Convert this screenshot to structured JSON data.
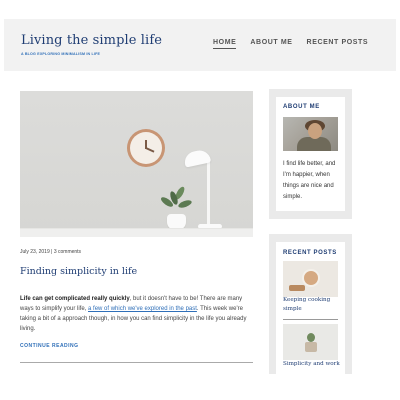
{
  "site": {
    "title": "Living the simple life",
    "tagline": "A BLOG EXPLORING MINIMALISM IN LIFE"
  },
  "nav": {
    "items": [
      {
        "label": "HOME",
        "active": true
      },
      {
        "label": "ABOUT ME",
        "active": false
      },
      {
        "label": "RECENT POSTS",
        "active": false
      }
    ]
  },
  "post": {
    "date": "July 23, 2019",
    "separator": " | ",
    "comments": "3 comments",
    "title": "Finding simplicity in life",
    "excerpt_bold": "Life can get complicated really quickly",
    "excerpt_part1": ", but it doesn't have to be! There are many ways to simplify your life, ",
    "excerpt_link": "a few of which we've explored in the past",
    "excerpt_part2": ". This week we're taking a bit of a approach though, in how you can find simplicity in the life you already living.",
    "continue_label": "CONTINUE READING"
  },
  "sidebar": {
    "about": {
      "title": "ABOUT ME",
      "text": "I find life better, and I'm happier, when things are nice and simple."
    },
    "recent": {
      "title": "RECENT POSTS",
      "items": [
        {
          "label": "Keeping cooking simple"
        },
        {
          "label": "Simplicity and work"
        }
      ]
    }
  },
  "colors": {
    "brand": "#1f3d73",
    "accent": "#2f6fb8",
    "header_bg": "#f2f2f2",
    "widget_bg": "#eaeaea"
  }
}
